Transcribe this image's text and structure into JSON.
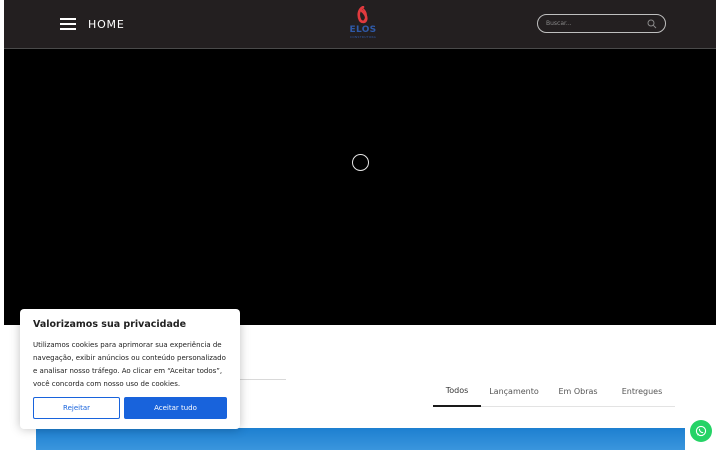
{
  "header": {
    "menu_label": "HOME",
    "logo_text": "ELOS",
    "logo_subtext": "CONSTRUTORA",
    "search_placeholder": "Buscar..."
  },
  "tabs": [
    {
      "label": "Todos",
      "active": true
    },
    {
      "label": "Lançamento",
      "active": false
    },
    {
      "label": "Em Obras",
      "active": false
    },
    {
      "label": "Entregues",
      "active": false
    }
  ],
  "cookie": {
    "title": "Valorizamos sua privacidade",
    "text": "Utilizamos cookies para aprimorar sua experiência de navegação, exibir anúncios ou conteúdo personalizado e analisar nosso tráfego. Ao clicar em “Aceitar todos”, você concorda com nosso uso de cookies.",
    "reject_label": "Rejeitar",
    "accept_label": "Aceitar tudo"
  },
  "icons": {
    "menu": "hamburger-icon",
    "search": "search-icon",
    "spinner": "loading-spinner",
    "whatsapp": "whatsapp-icon"
  },
  "colors": {
    "header_bg": "#231f20",
    "brand_blue": "#2f5aa8",
    "brand_red": "#e03a3e",
    "cookie_button": "#1863dc",
    "whatsapp": "#25d366"
  }
}
